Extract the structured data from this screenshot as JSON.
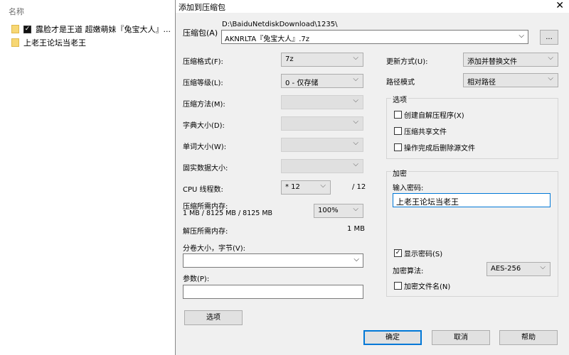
{
  "explorer": {
    "column_name": "名称",
    "files": [
      {
        "name": "露脸才是王道 超嫩萌妹『兔宝大人』...",
        "checked": true
      },
      {
        "name": "上老王论坛当老王",
        "checked": false
      }
    ]
  },
  "dialog": {
    "title": "添加到压缩包",
    "archive": {
      "label": "压缩包(A)",
      "path": "D:\\BaiduNetdiskDownload\\1235\\",
      "name": "AKNRLTA『兔宝大人』.7z",
      "browse": "..."
    },
    "format": {
      "label": "压缩格式(F):",
      "value": "7z"
    },
    "level": {
      "label": "压缩等级(L):",
      "value": "0 - 仅存储"
    },
    "method": {
      "label": "压缩方法(M):"
    },
    "dict": {
      "label": "字典大小(D):"
    },
    "word": {
      "label": "单词大小(W):"
    },
    "solid": {
      "label": "固实数据大小:"
    },
    "cpu": {
      "label": "CPU 线程数:",
      "value": "* 12",
      "max": "/ 12"
    },
    "mem_compress": {
      "label": "压缩所需内存:",
      "value": "1 MB / 8125 MB / 8125 MB",
      "percent": "100%"
    },
    "mem_decompress": {
      "label": "解压所需内存:",
      "value": "1 MB"
    },
    "split": {
      "label": "分卷大小，字节(V):",
      "value": ""
    },
    "params": {
      "label": "参数(P):",
      "value": ""
    },
    "options_btn": "选项",
    "update": {
      "label": "更新方式(U):",
      "value": "添加并替换文件"
    },
    "path_mode": {
      "label": "路径模式",
      "value": "相对路径"
    },
    "options": {
      "title": "选项",
      "items": [
        {
          "label": "创建自解压程序(X)",
          "checked": false
        },
        {
          "label": "压缩共享文件",
          "checked": false
        },
        {
          "label": "操作完成后删除源文件",
          "checked": false
        }
      ]
    },
    "encryption": {
      "title": "加密",
      "password_label": "输入密码:",
      "password": "上老王论坛当老王",
      "show_password": {
        "label": "显示密码(S)",
        "checked": true
      },
      "algo_label": "加密算法:",
      "algo": "AES-256",
      "encrypt_names": {
        "label": "加密文件名(N)",
        "checked": false
      }
    },
    "buttons": {
      "ok": "确定",
      "cancel": "取消",
      "help": "帮助"
    }
  }
}
